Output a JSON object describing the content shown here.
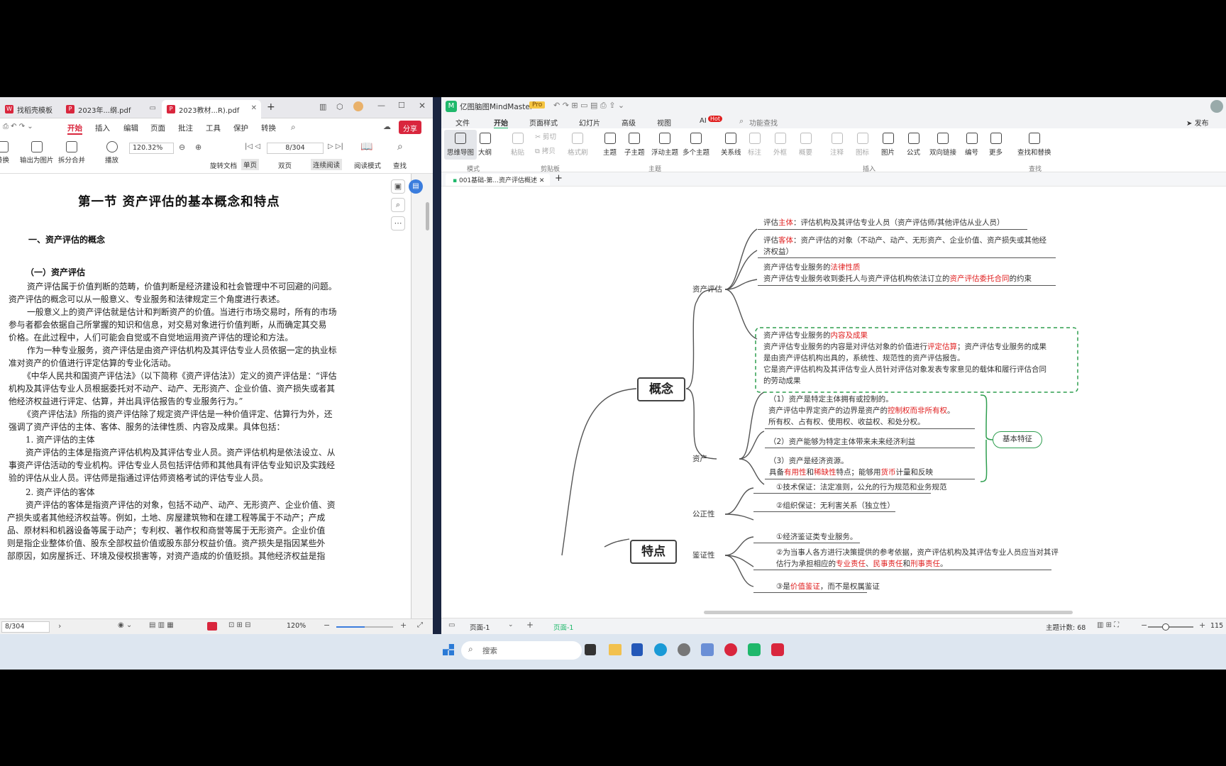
{
  "pdf_app": {
    "tabs": [
      {
        "label": "找稻壳模板"
      },
      {
        "label": "2023年...纲.pdf"
      },
      {
        "label": "2023教材...R).pdf"
      }
    ],
    "menu": [
      "开始",
      "插入",
      "编辑",
      "页面",
      "批注",
      "工具",
      "保护",
      "转换"
    ],
    "share_label": "分享",
    "ribbon": {
      "export_label": "转换",
      "output_image": "输出为图片",
      "split_merge": "拆分合并",
      "play": "播放",
      "zoom_value": "120.32%",
      "page_value": "8/304",
      "rotate": "旋转文档",
      "single": "单页",
      "double": "双页",
      "continuous": "连续阅读",
      "read_mode": "阅读模式",
      "find": "查找"
    },
    "doc": {
      "title": "第一节 资产评估的基本概念和特点",
      "h1": "一、资产评估的概念",
      "h2": "（一）资产评估",
      "paragraphs": [
        "资产评估属于价值判断的范畴，价值判断是经济建设和社会管理中不可回避的问题。",
        "资产评估的概念可以从一般意义、专业服务和法律规定三个角度进行表述。",
        "一般意义上的资产评估就是估计和判断资产的价值。当进行市场交易时，所有的市场",
        "参与者都会依据自己所掌握的知识和信息，对交易对象进行价值判断，从而确定其交易",
        "价格。在此过程中，人们可能会自觉或不自觉地运用资产评估的理论和方法。",
        "作为一种专业服务，资产评估是由资产评估机构及其评估专业人员依据一定的执业标",
        "准对资产的价值进行评定估算的专业化活动。",
        "《中华人民共和国资产评估法》（以下简称《资产评估法》）定义的资产评估是：“评估",
        "机构及其评估专业人员根据委托对不动产、动产、无形资产、企业价值、资产损失或者其",
        "他经济权益进行评定、估算，并出具评估报告的专业服务行为。”",
        "《资产评估法》所指的资产评估除了规定资产评估是一种价值评定、估算行为外，还",
        "强调了资产评估的主体、客体、服务的法律性质、内容及成果。具体包括：",
        "1. 资产评估的主体",
        "资产评估的主体是指资产评估机构及其评估专业人员。资产评估机构是依法设立、从",
        "事资产评估活动的专业机构。评估专业人员包括评估师和其他具有评估专业知识及实践经",
        "验的评估从业人员。评估师是指通过评估师资格考试的评估专业人员。",
        "2. 资产评估的客体",
        "资产评估的客体是指资产评估的对象，包括不动产、动产、无形资产、企业价值、资",
        "产损失或者其他经济权益等。例如，土地、房屋建筑物和在建工程等属于不动产；产成",
        "品、原材料和机器设备等属于动产；专利权、著作权和商誉等属于无形资产。企业价值",
        "则是指企业整体价值、股东全部权益价值或股东部分权益价值。资产损失是指因某些外",
        "部原因，如房屋拆迁、环境及侵权损害等，对资产造成的价值贬损。其他经济权益是指"
      ]
    },
    "status": {
      "page": "8/304",
      "zoom": "120%"
    }
  },
  "mindmaster": {
    "app_title": "亿图脑图MindMaster",
    "pro_badge": "Pro",
    "menu": [
      "文件",
      "开始",
      "页面样式",
      "幻灯片",
      "高级",
      "视图",
      "AI",
      "功能查找"
    ],
    "hot_badge": "Hot",
    "publish": "发布",
    "ribbon": {
      "mode": [
        "思维导图",
        "大纲"
      ],
      "clipboard": [
        "粘贴",
        "剪切",
        "拷贝",
        "格式刷"
      ],
      "topic": [
        "主题",
        "子主题",
        "浮动主题",
        "多个主题"
      ],
      "relations": [
        "关系线",
        "标注",
        "外框",
        "概要"
      ],
      "insert": [
        "注释",
        "图标",
        "图片",
        "公式",
        "双向链接",
        "编号",
        "更多"
      ],
      "find": "查找和替换",
      "groups": [
        "模式",
        "剪贴板",
        "主题",
        "插入",
        "查找"
      ]
    },
    "doc_tab": "001基础-第...资产评估概述",
    "map": {
      "root1": "概念",
      "root2": "特点",
      "branch_pingu": "资产评估",
      "branch_zichan": "资产",
      "branch_gongzheng": "公正性",
      "branch_jianzheng": "鉴证性",
      "summary": "基本特征",
      "t1": [
        "评估",
        "主体",
        "：评估机构及其评估专业人员（资产评估师/其他评估从业人员）"
      ],
      "t2": [
        "评估",
        "客体",
        "：资产评估的对象（不动产、动产、无形资产、企业价值、资产损失或其他经",
        "济权益）"
      ],
      "t3": [
        "资产评估专业服务的",
        "法律性质",
        "资产评估专业服务收到委托人与资产评估机构依法订立的",
        "资产评估委托合同",
        "的约束"
      ],
      "t4": [
        "资产评估专业服务的",
        "内容及成果",
        "资产评估专业服务的内容是对评估对象的价值进行",
        "评定估算",
        "；资产评估专业服务的成果",
        "是由资产评估机构出具的，系统性、规范性的资产评估报告。",
        "它是资产评估机构及其评估专业人员针对评估对象发表专家意见的载体和履行评估合同",
        "的劳动成果"
      ],
      "a1": [
        "（1）资产是特定主体拥有或控制的。",
        "资产评估中界定资产的边界是资产的",
        "控制权而非所有权",
        "。",
        "所有权、占有权、使用权、收益权、和处分权。"
      ],
      "a2": "（2）资产能够为特定主体带来未来经济利益",
      "a3": [
        "（3）资产是经济资源。",
        "具备",
        "有用性",
        "和",
        "稀缺性",
        "特点；能够用",
        "货币",
        "计量和反映"
      ],
      "g1": "①技术保证：法定准则，公允的行为规范和业务规范",
      "g2": "②组织保证：无利害关系（独立性）",
      "j1": "①经济鉴证类专业服务。",
      "j2": [
        "②为当事人各方进行决策提供的参考依据，资产评估机构及其评估专业人员应当对其评",
        "估行为承担相应的",
        "专业责任",
        "、",
        "民事责任",
        "和",
        "刑事责任",
        "。"
      ],
      "j3": [
        "③是",
        "价值鉴证",
        "，而不是权属鉴证"
      ]
    },
    "status": {
      "page_select": "页面-1",
      "page_tab": "页面-1",
      "topic_count": "主题计数: 68",
      "zoom": "115"
    }
  },
  "taskbar": {
    "search_placeholder": "搜索"
  },
  "colors": {
    "accent_red": "#e02020",
    "summary_green": "#2e9e4f",
    "pdf_brand": "#d9263d",
    "mm_brand": "#1fb86b"
  }
}
